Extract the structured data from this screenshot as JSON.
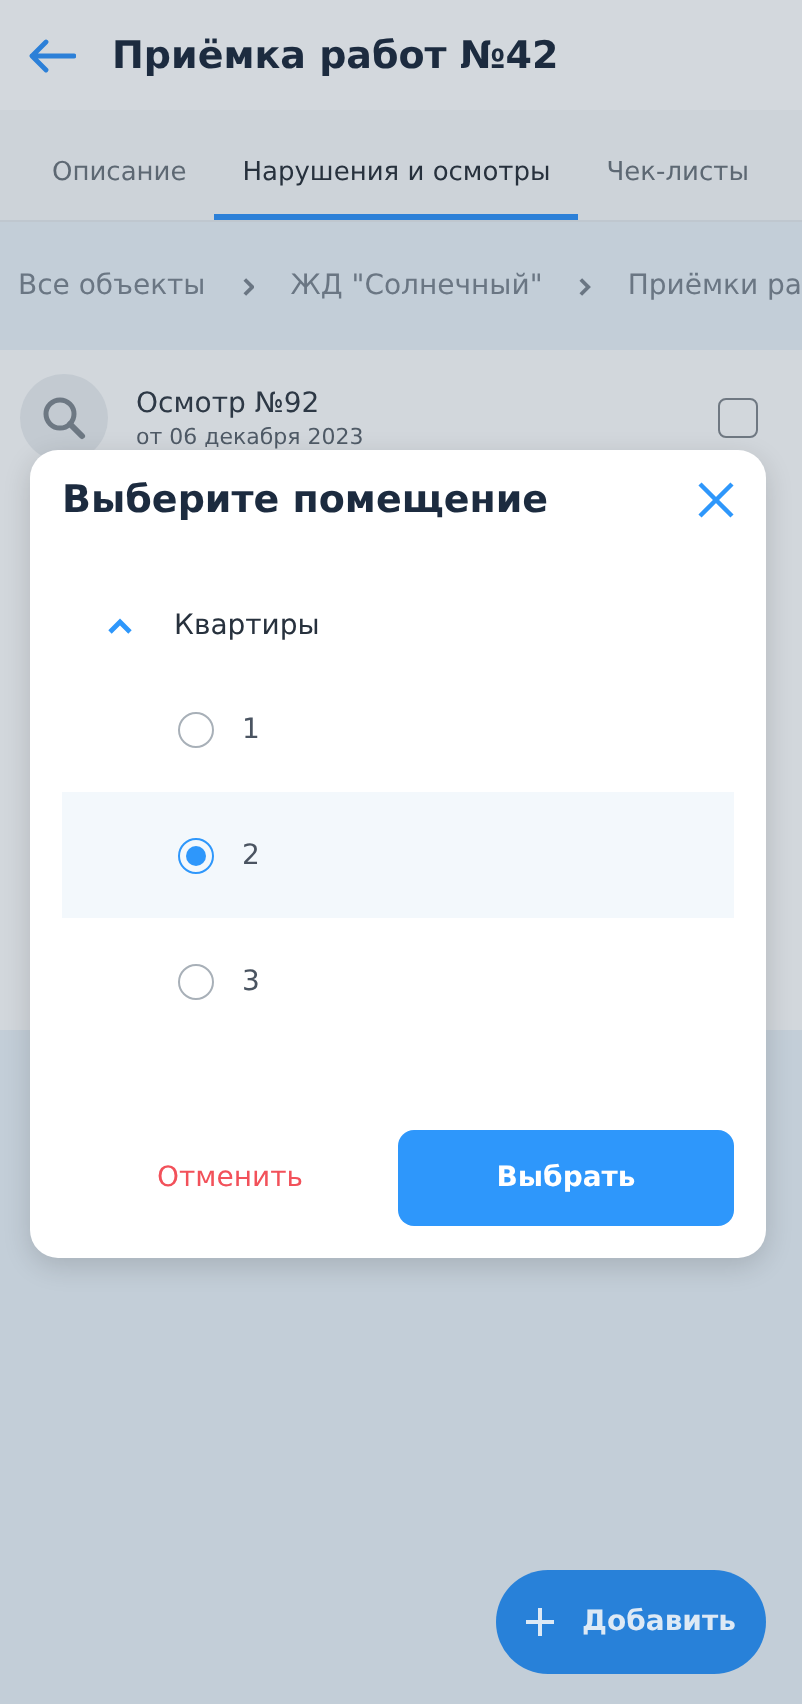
{
  "header": {
    "title": "Приёмка работ №42"
  },
  "tabs": [
    {
      "label": "Описание",
      "selected": false
    },
    {
      "label": "Нарушения и осмотры",
      "selected": true
    },
    {
      "label": "Чек-листы",
      "selected": false
    }
  ],
  "breadcrumbs": [
    "Все объекты",
    "ЖД \"Солнечный\"",
    "Приёмки ра"
  ],
  "card": {
    "title": "Осмотр №92",
    "subtitle": "от 06 декабря 2023",
    "checked": false
  },
  "dialog": {
    "title": "Выберите помещение",
    "group": {
      "label": "Квартиры",
      "expanded": true,
      "options": [
        {
          "label": "1",
          "selected": false
        },
        {
          "label": "2",
          "selected": true
        },
        {
          "label": "3",
          "selected": false
        }
      ]
    },
    "cancel": "Отменить",
    "confirm": "Выбрать"
  },
  "fab": {
    "label": "Добавить"
  }
}
